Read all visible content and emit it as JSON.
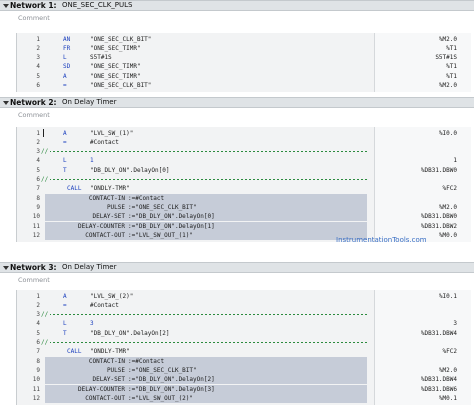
{
  "networks": [
    {
      "label": "Network 1:",
      "title": "ONE_SEC_CLK_PULS",
      "comment": "Comment",
      "lines": [
        {
          "n": "1",
          "op": "AN",
          "arg": "\"ONE_SEC_CLK_BIT\"",
          "val": "%M2.0"
        },
        {
          "n": "2",
          "op": "FR",
          "arg": "\"ONE_SEC_TIMR\"",
          "val": "%T1"
        },
        {
          "n": "3",
          "op": "L",
          "arg": "S5T#1S",
          "val": "S5T#1S"
        },
        {
          "n": "4",
          "op": "SD",
          "arg": "\"ONE_SEC_TIMR\"",
          "val": "%T1"
        },
        {
          "n": "5",
          "op": "A",
          "arg": "\"ONE_SEC_TIMR\"",
          "val": "%T1"
        },
        {
          "n": "6",
          "op": "=",
          "arg": "\"ONE_SEC_CLK_BIT\"",
          "val": "%M2.0"
        }
      ]
    },
    {
      "label": "Network 2:",
      "title": "On Delay Timer",
      "comment": "Comment",
      "lines": [
        {
          "n": "1",
          "op": "A",
          "arg": "\"LVL_SW_(1)\"",
          "val": "%I0.0"
        },
        {
          "n": "2",
          "op": "=",
          "arg": "#Contact",
          "val": ""
        },
        {
          "n": "3",
          "sep": "//"
        },
        {
          "n": "4",
          "op": "L",
          "arg": "1",
          "val": "1"
        },
        {
          "n": "5",
          "op": "T",
          "arg": "\"DB_DLY_ON\".DelayOn[0]",
          "val": "%DB31.DBW0"
        },
        {
          "n": "6",
          "sep": "//"
        },
        {
          "n": "7",
          "op": "CALL",
          "arg": "\"ONDLY-TMR\"",
          "val": "%FC2"
        },
        {
          "n": "8",
          "param": "CONTACT-IN",
          "assign": ":=#Contact",
          "val": ""
        },
        {
          "n": "9",
          "param": "PULSE",
          "assign": ":=\"ONE_SEC_CLK_BIT\"",
          "val": "%M2.0"
        },
        {
          "n": "10",
          "param": "DELAY-SET",
          "assign": ":=\"DB_DLY_ON\".DelayOn[0]",
          "val": "%DB31.DBW0"
        },
        {
          "n": "11",
          "param": "DELAY-COUNTER",
          "assign": ":=\"DB_DLY_ON\".DelayOn[1]",
          "val": "%DB31.DBW2"
        },
        {
          "n": "12",
          "param": "CONTACT-OUT",
          "assign": ":=\"LVL_SW_OUT_(1)\"",
          "val": "%M0.0"
        }
      ]
    },
    {
      "label": "Network 3:",
      "title": "On Delay Timer",
      "comment": "Comment",
      "lines": [
        {
          "n": "1",
          "op": "A",
          "arg": "\"LVL_SW_(2)\"",
          "val": "%I0.1"
        },
        {
          "n": "2",
          "op": "=",
          "arg": "#Contact",
          "val": ""
        },
        {
          "n": "3",
          "sep": "//"
        },
        {
          "n": "4",
          "op": "L",
          "arg": "3",
          "val": "3"
        },
        {
          "n": "5",
          "op": "T",
          "arg": "\"DB_DLY_ON\".DelayOn[2]",
          "val": "%DB31.DBW4"
        },
        {
          "n": "6",
          "sep": "//"
        },
        {
          "n": "7",
          "op": "CALL",
          "arg": "\"ONDLY-TMR\"",
          "val": "%FC2"
        },
        {
          "n": "8",
          "param": "CONTACT-IN",
          "assign": ":=#Contact",
          "val": ""
        },
        {
          "n": "9",
          "param": "PULSE",
          "assign": ":=\"ONE_SEC_CLK_BIT\"",
          "val": "%M2.0"
        },
        {
          "n": "10",
          "param": "DELAY-SET",
          "assign": ":=\"DB_DLY_ON\".DelayOn[2]",
          "val": "%DB31.DBW4"
        },
        {
          "n": "11",
          "param": "DELAY-COUNTER",
          "assign": ":=\"DB_DLY_ON\".DelayOn[3]",
          "val": "%DB31.DBW6"
        },
        {
          "n": "12",
          "param": "CONTACT-OUT",
          "assign": ":=\"LVL_SW_OUT_(2)\"",
          "val": "%M0.1"
        }
      ]
    }
  ],
  "watermark": "InstrumentationTools.com",
  "colors": {
    "keyword": "#1b3fbe",
    "comment_sep": "#2b8a3e",
    "header_bg": "#dfe3e6",
    "code_bg": "#f2f3f4",
    "selected": "#c6ccd8",
    "watermark": "#3a6fc4"
  }
}
